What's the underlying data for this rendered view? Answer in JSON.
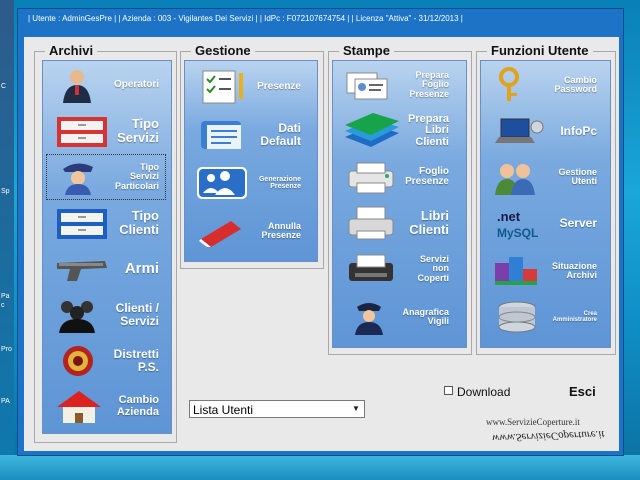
{
  "desktop": {
    "left_labels": [
      "C",
      "Sp",
      "Pa",
      "c",
      "Pro",
      "PA"
    ]
  },
  "titlebar": {
    "text": "| Utente : AdminGesPre    |  | Azienda : 003 - Vigilantes Dei Servizi        |   | IdPc : F072107674754 |  | Licenza \"Attiva\" - 31/12/2013 |"
  },
  "groups": {
    "archivi": {
      "title": "Archivi",
      "items": [
        {
          "label": "Operatori",
          "icon": "operator-person-icon"
        },
        {
          "label": "Tipo\nServizi",
          "icon": "red-drawer-icon"
        },
        {
          "label": "Tipo\nServizi\nParticolari",
          "icon": "police-guard-icon"
        },
        {
          "label": "Tipo\nClienti",
          "icon": "blue-drawer-icon"
        },
        {
          "label": "Armi",
          "icon": "pistol-icon"
        },
        {
          "label": "Clienti /\nServizi",
          "icon": "users-group-icon"
        },
        {
          "label": "Distretti\nP.S.",
          "icon": "police-badge-icon"
        },
        {
          "label": "Cambio\nAzienda",
          "icon": "house-icon"
        }
      ]
    },
    "gestione": {
      "title": "Gestione",
      "items": [
        {
          "label": "Presenze",
          "icon": "checklist-icon"
        },
        {
          "label": "Dati\nDefault",
          "icon": "document-stack-icon"
        },
        {
          "label": "Generazione\nPresenze",
          "icon": "team-meeting-icon"
        },
        {
          "label": "Annulla\nPresenze",
          "icon": "eraser-icon"
        }
      ]
    },
    "stampe": {
      "title": "Stampe",
      "items": [
        {
          "label": "Prepara\nFoglio\nPresenze",
          "icon": "id-cards-icon"
        },
        {
          "label": "Prepara\nLibri\nClienti",
          "icon": "books-icon"
        },
        {
          "label": "Foglio\nPresenze",
          "icon": "printer-icon"
        },
        {
          "label": "Libri\nClienti",
          "icon": "printer-paper-icon"
        },
        {
          "label": "Servizi\nnon\nCoperti",
          "icon": "fax-printer-icon"
        },
        {
          "label": "Anagrafica\nVigili",
          "icon": "police-officer-icon"
        }
      ]
    },
    "funzioni": {
      "title": "Funzioni Utente",
      "items": [
        {
          "label": "Cambio\nPassword",
          "icon": "key-icon"
        },
        {
          "label": "InfoPc",
          "icon": "laptop-icon"
        },
        {
          "label": "Gestione\nUtenti",
          "icon": "users-manage-icon"
        },
        {
          "label": "Server",
          "icon": "dotnet-mysql-icon"
        },
        {
          "label": "Situazione\nArchivi",
          "icon": "cubes-chart-icon"
        },
        {
          "label": "Crea\nAmministratore",
          "icon": "database-icon"
        }
      ]
    }
  },
  "bottom": {
    "select_value": "Lista Utenti",
    "download_label": "Download",
    "esci_label": "Esci",
    "url": "www.ServizieCoperture.it",
    "url_mirrored": "www.ServizieCoperture.it"
  }
}
